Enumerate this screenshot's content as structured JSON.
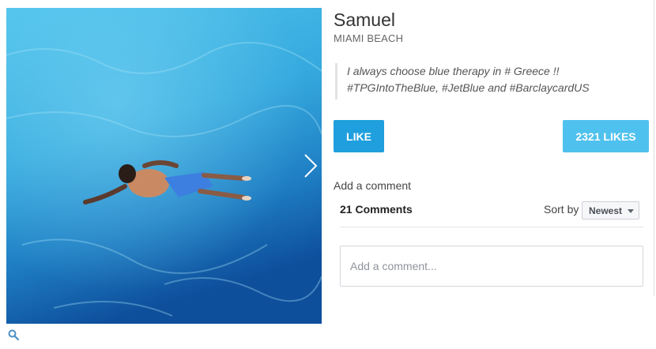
{
  "post": {
    "user_name": "Samuel",
    "location": "MIAMI BEACH",
    "caption_lines": [
      "I always choose blue therapy in # Greece !!",
      "#TPGIntoTheBlue, #JetBlue and #BarclaycardUS"
    ]
  },
  "actions": {
    "like_label": "LIKE",
    "likes_count_label": "2321 LIKES"
  },
  "comments": {
    "add_label": "Add a comment",
    "count_label": "21 Comments",
    "sort_label": "Sort by",
    "sort_selected": "Newest",
    "input_placeholder": "Add a comment..."
  },
  "icons": {
    "next": "chevron-right-icon",
    "zoom": "search-icon"
  },
  "colors": {
    "like_button": "#1f9fdd",
    "likes_count": "#4fc1ee",
    "pool_water": "#3fb0e0"
  }
}
